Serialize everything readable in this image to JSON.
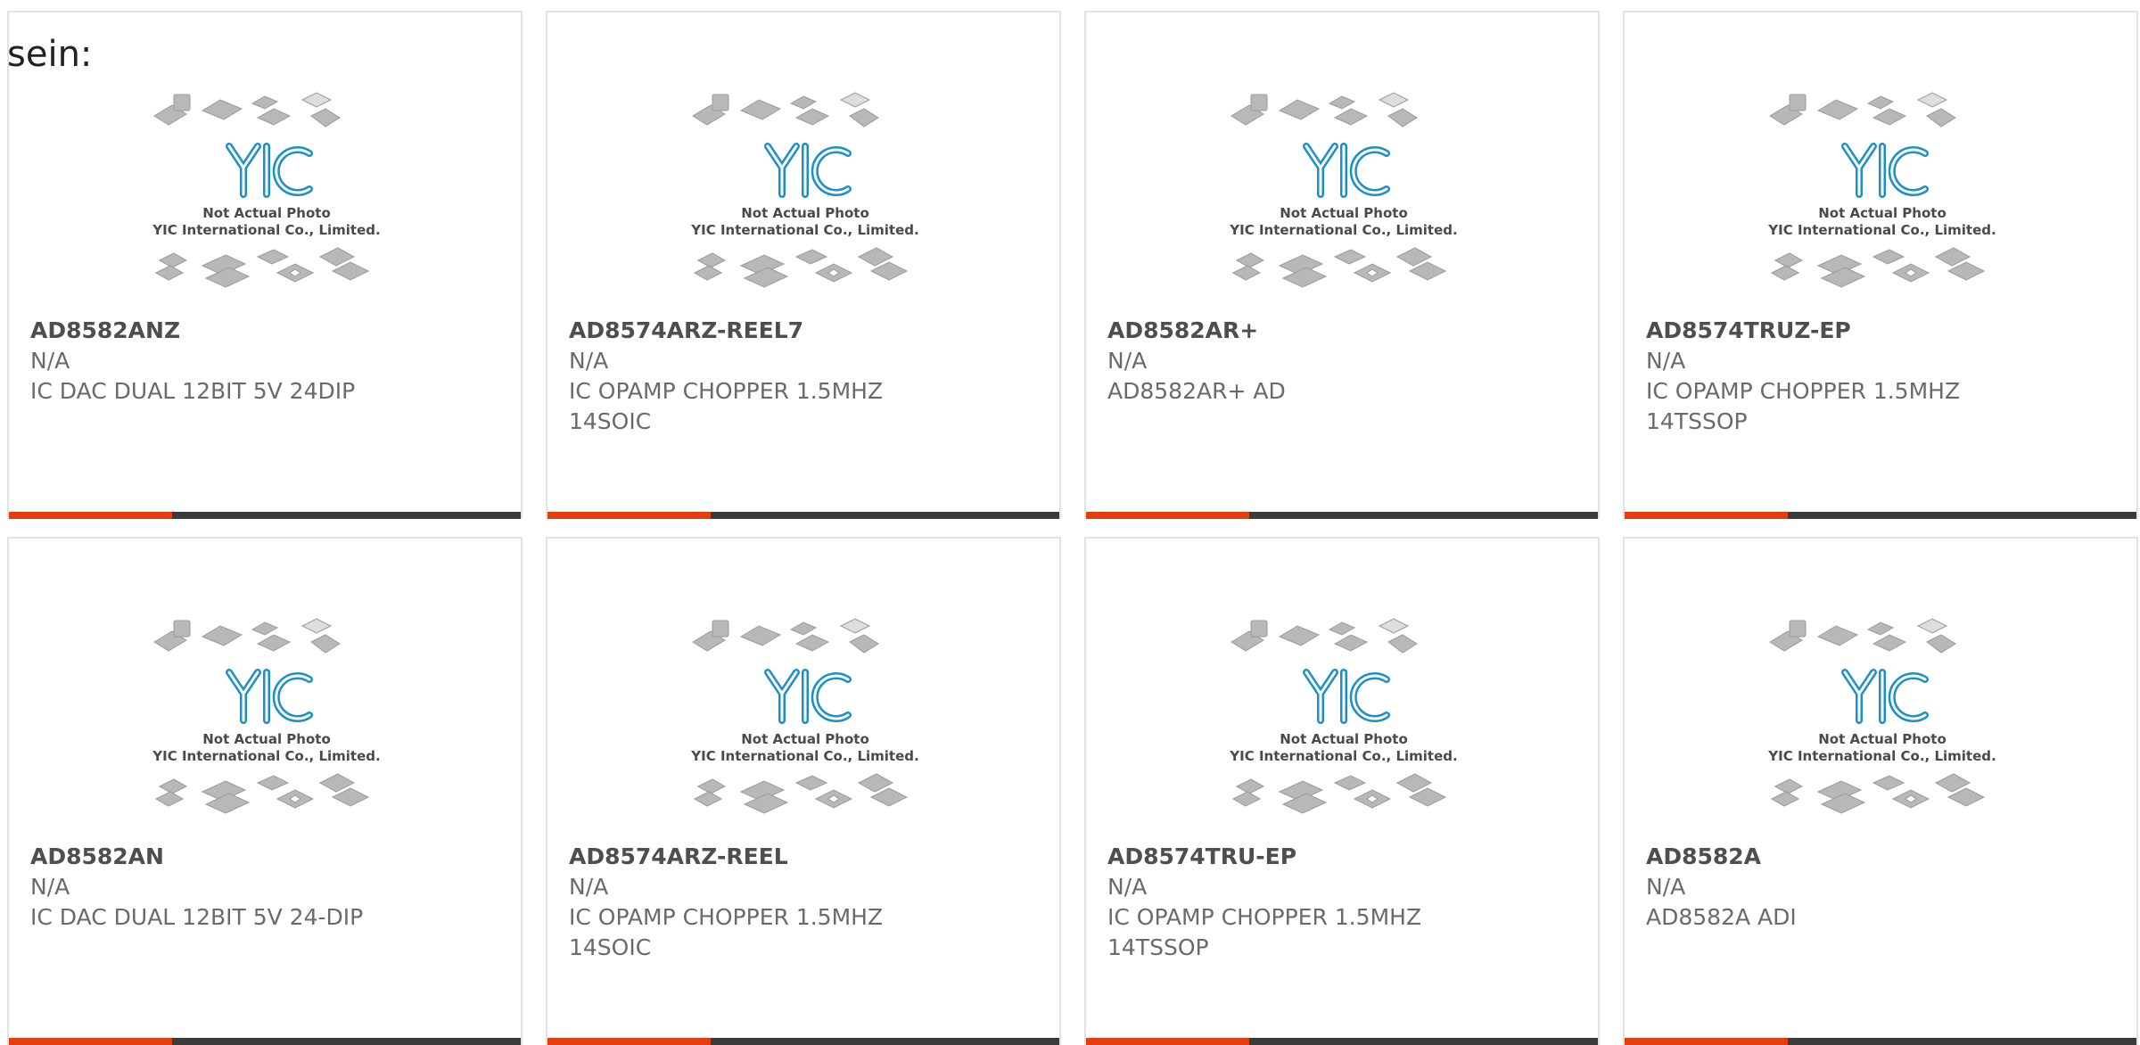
{
  "intro_text": "sein:",
  "accent_color": "#e43d0e",
  "placeholder": {
    "line1": "Not Actual Photo",
    "line2": "YIC International Co., Limited.",
    "logo": "YIC"
  },
  "products": [
    {
      "part_number": "AD8582ANZ",
      "manufacturer": "N/A",
      "description": "IC DAC DUAL 12BIT 5V 24DIP"
    },
    {
      "part_number": "AD8574ARZ-REEL7",
      "manufacturer": "N/A",
      "description": "IC OPAMP CHOPPER 1.5MHZ 14SOIC"
    },
    {
      "part_number": "AD8582AR+",
      "manufacturer": "N/A",
      "description": "AD8582AR+ AD"
    },
    {
      "part_number": "AD8574TRUZ-EP",
      "manufacturer": "N/A",
      "description": "IC OPAMP CHOPPER 1.5MHZ 14TSSOP"
    },
    {
      "part_number": "AD8582AN",
      "manufacturer": "N/A",
      "description": "IC DAC DUAL 12BIT 5V 24-DIP"
    },
    {
      "part_number": "AD8574ARZ-REEL",
      "manufacturer": "N/A",
      "description": "IC OPAMP CHOPPER 1.5MHZ 14SOIC"
    },
    {
      "part_number": "AD8574TRU-EP",
      "manufacturer": "N/A",
      "description": "IC OPAMP CHOPPER 1.5MHZ 14TSSOP"
    },
    {
      "part_number": "AD8582A",
      "manufacturer": "N/A",
      "description": "AD8582A ADI"
    }
  ]
}
